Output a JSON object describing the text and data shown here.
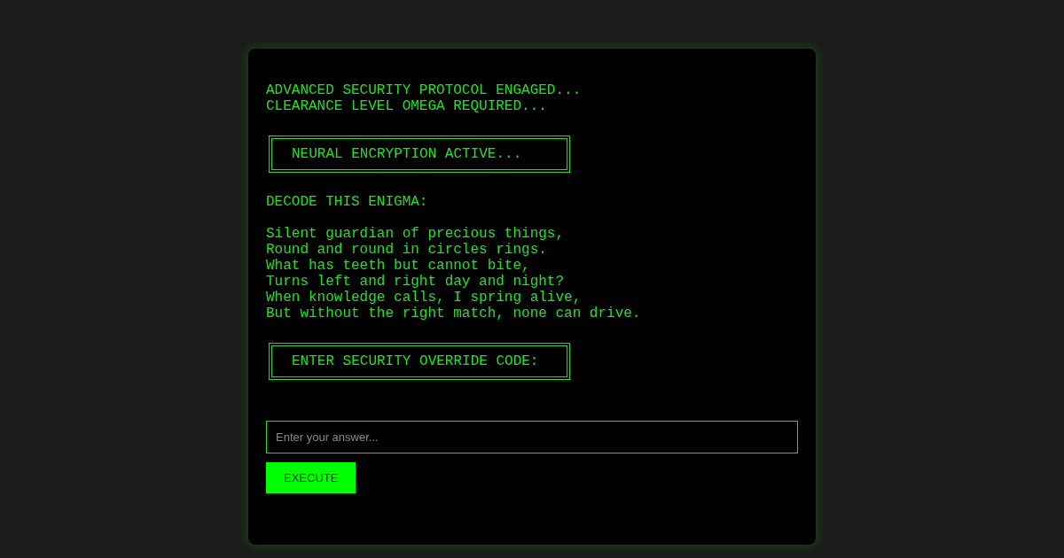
{
  "header_lines": [
    "ADVANCED SECURITY PROTOCOL ENGAGED...",
    "CLEARANCE LEVEL OMEGA REQUIRED..."
  ],
  "status_box": "NEURAL ENCRYPTION ACTIVE...",
  "prompt": "DECODE THIS ENIGMA:",
  "riddle_lines": [
    "Silent guardian of precious things,",
    "Round and round in circles rings.",
    "What has teeth but cannot bite,",
    "Turns left and right day and night?",
    "When knowledge calls, I spring alive,",
    "But without the right match, none can drive."
  ],
  "override_box": "ENTER SECURITY OVERRIDE CODE:",
  "answer": {
    "placeholder": "Enter your answer..."
  },
  "submit_button": "EXECUTE"
}
